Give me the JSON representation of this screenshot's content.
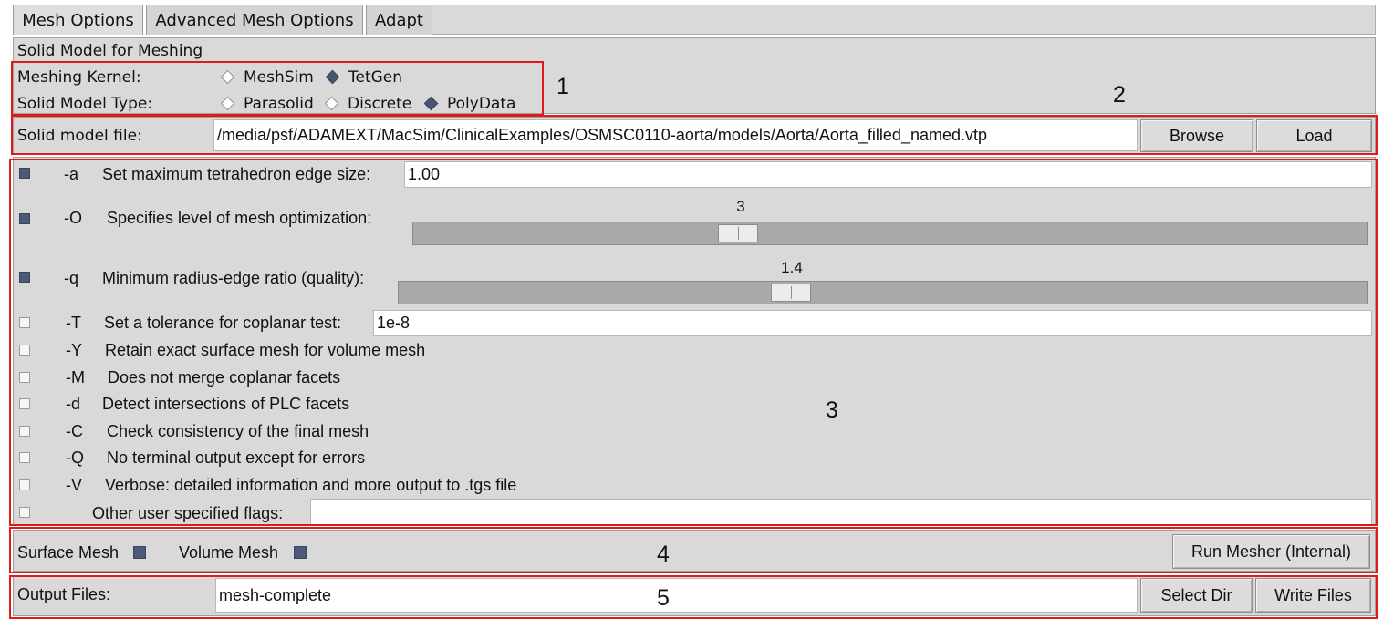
{
  "tabs": [
    {
      "label": "Mesh Options"
    },
    {
      "label": "Advanced Mesh Options"
    },
    {
      "label": "Adapt"
    }
  ],
  "solid_model": {
    "section_title": "Solid Model for Meshing",
    "kernel_label": "Meshing Kernel:",
    "kernel_options": [
      {
        "label": "MeshSim",
        "selected": false
      },
      {
        "label": "TetGen",
        "selected": true
      }
    ],
    "type_label": "Solid Model Type:",
    "type_options": [
      {
        "label": "Parasolid",
        "selected": false
      },
      {
        "label": "Discrete",
        "selected": false
      },
      {
        "label": "PolyData",
        "selected": true
      }
    ],
    "file_label": "Solid model file:",
    "file_value": "/media/psf/ADAMEXT/MacSim/ClinicalExamples/OSMSC0110-aorta/models/Aorta/Aorta_filled_named.vtp",
    "browse_label": "Browse",
    "load_label": "Load"
  },
  "options": {
    "a": {
      "flag": "-a",
      "label": "Set maximum tetrahedron edge size:",
      "value": "1.00",
      "checked": true
    },
    "O": {
      "flag": "-O",
      "label": "Specifies level of mesh optimization:",
      "value": "3",
      "checked": true
    },
    "q": {
      "flag": "-q",
      "label": "Minimum radius-edge ratio (quality):",
      "value": "1.4",
      "checked": true
    },
    "T": {
      "flag": "-T",
      "label": "Set a tolerance for coplanar test:",
      "value": "1e-8",
      "checked": false
    },
    "Y": {
      "flag": "-Y",
      "label": "Retain exact surface mesh for volume mesh",
      "checked": false
    },
    "M": {
      "flag": "-M",
      "label": "Does not merge coplanar facets",
      "checked": false
    },
    "d": {
      "flag": "-d",
      "label": "Detect intersections of PLC facets",
      "checked": false
    },
    "C": {
      "flag": "-C",
      "label": "Check consistency of the final mesh",
      "checked": false
    },
    "Q": {
      "flag": "-Q",
      "label": "No terminal output except for errors",
      "checked": false
    },
    "V": {
      "flag": "-V",
      "label": "Verbose: detailed information and more output to .tgs file",
      "checked": false
    },
    "other": {
      "label": "Other user specified flags:",
      "value": "",
      "checked": false
    }
  },
  "mesh_run": {
    "surface_label": "Surface Mesh",
    "surface_checked": true,
    "volume_label": "Volume Mesh",
    "volume_checked": true,
    "run_label": "Run Mesher (Internal)"
  },
  "output": {
    "label": "Output Files:",
    "value": "mesh-complete",
    "select_dir_label": "Select Dir",
    "write_files_label": "Write Files"
  },
  "annotations": [
    "1",
    "2",
    "3",
    "4",
    "5"
  ],
  "colors": {
    "highlight_box": "#e01919",
    "panel_bg": "#d9d9d9",
    "check_on": "#4a5a78"
  }
}
